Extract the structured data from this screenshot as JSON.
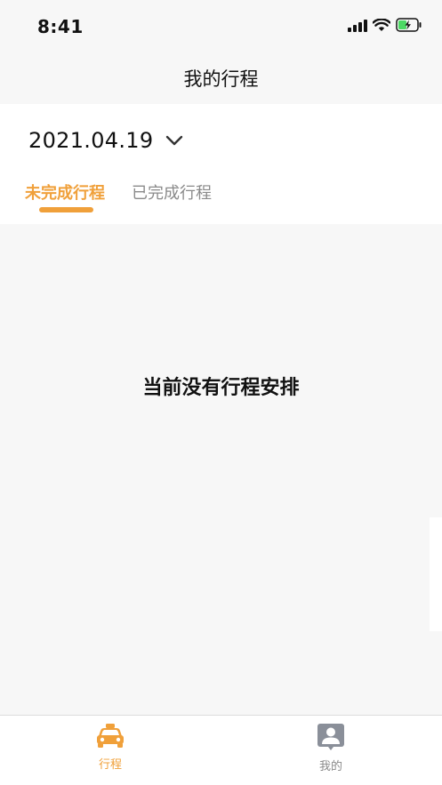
{
  "status_bar": {
    "time": "8:41",
    "icons": [
      "signal-icon",
      "wifi-icon",
      "battery-charging-icon"
    ]
  },
  "nav": {
    "title": "我的行程"
  },
  "date_selector": {
    "date": "2021.04.19",
    "icon": "chevron-down-icon"
  },
  "tabs": [
    {
      "label": "未完成行程",
      "active": true
    },
    {
      "label": "已完成行程",
      "active": false
    }
  ],
  "empty_state": {
    "message": "当前没有行程安排"
  },
  "tab_bar": {
    "items": [
      {
        "label": "行程",
        "icon": "taxi-icon",
        "active": true
      },
      {
        "label": "我的",
        "icon": "profile-icon",
        "active": false
      }
    ]
  },
  "colors": {
    "accent": "#f0a03a",
    "inactive": "#8a8a8a",
    "background": "#f7f7f7",
    "battery": "#4cd964"
  }
}
